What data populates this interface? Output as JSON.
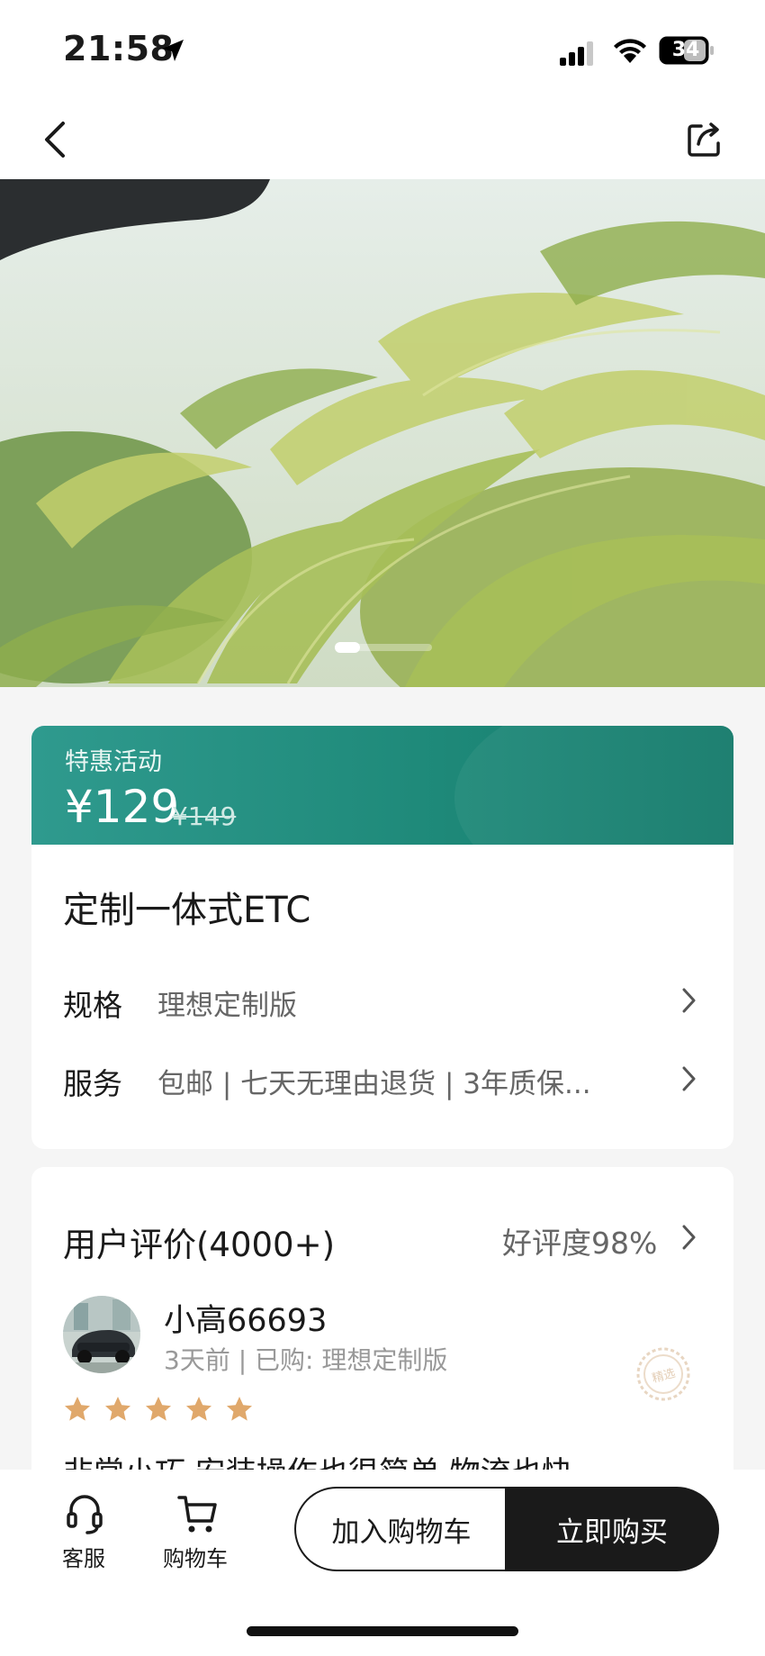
{
  "status_bar": {
    "time": "21:58",
    "battery": "34"
  },
  "icons": {
    "back": "chevron-left-icon",
    "share": "share-icon",
    "location": "location-arrow-icon",
    "signal": "signal-icon",
    "wifi": "wifi-icon",
    "battery": "battery-icon",
    "customer_service": "headset-icon",
    "cart": "cart-icon",
    "star": "star-icon",
    "featured": "featured-seal-icon"
  },
  "hero": {
    "image": "palm trees",
    "carousel_index": 1
  },
  "promo": {
    "label": "特惠活动",
    "price": "¥129",
    "original_price": "¥149"
  },
  "product": {
    "title": "定制一体式ETC",
    "spec": {
      "label": "规格",
      "value": "理想定制版"
    },
    "service": {
      "label": "服务",
      "value": "包邮 | 七天无理由退货 | 3年质保..."
    }
  },
  "reviews": {
    "title": "用户评价(4000+)",
    "rating": "好评度98%",
    "items": [
      {
        "user": "小高66693",
        "meta": "3天前 | 已购: 理想定制版",
        "stars": 5,
        "badge": "精选",
        "text": "非常小巧 安装操作也很简单 物流也快"
      }
    ]
  },
  "bottom_bar": {
    "customer_service": "客服",
    "cart": "购物车",
    "add_to_cart": "加入购物车",
    "buy_now": "立即购买"
  },
  "colors": {
    "accent": "#1f8a7a",
    "star": "#e0a86b",
    "dark": "#1a1a1a"
  }
}
